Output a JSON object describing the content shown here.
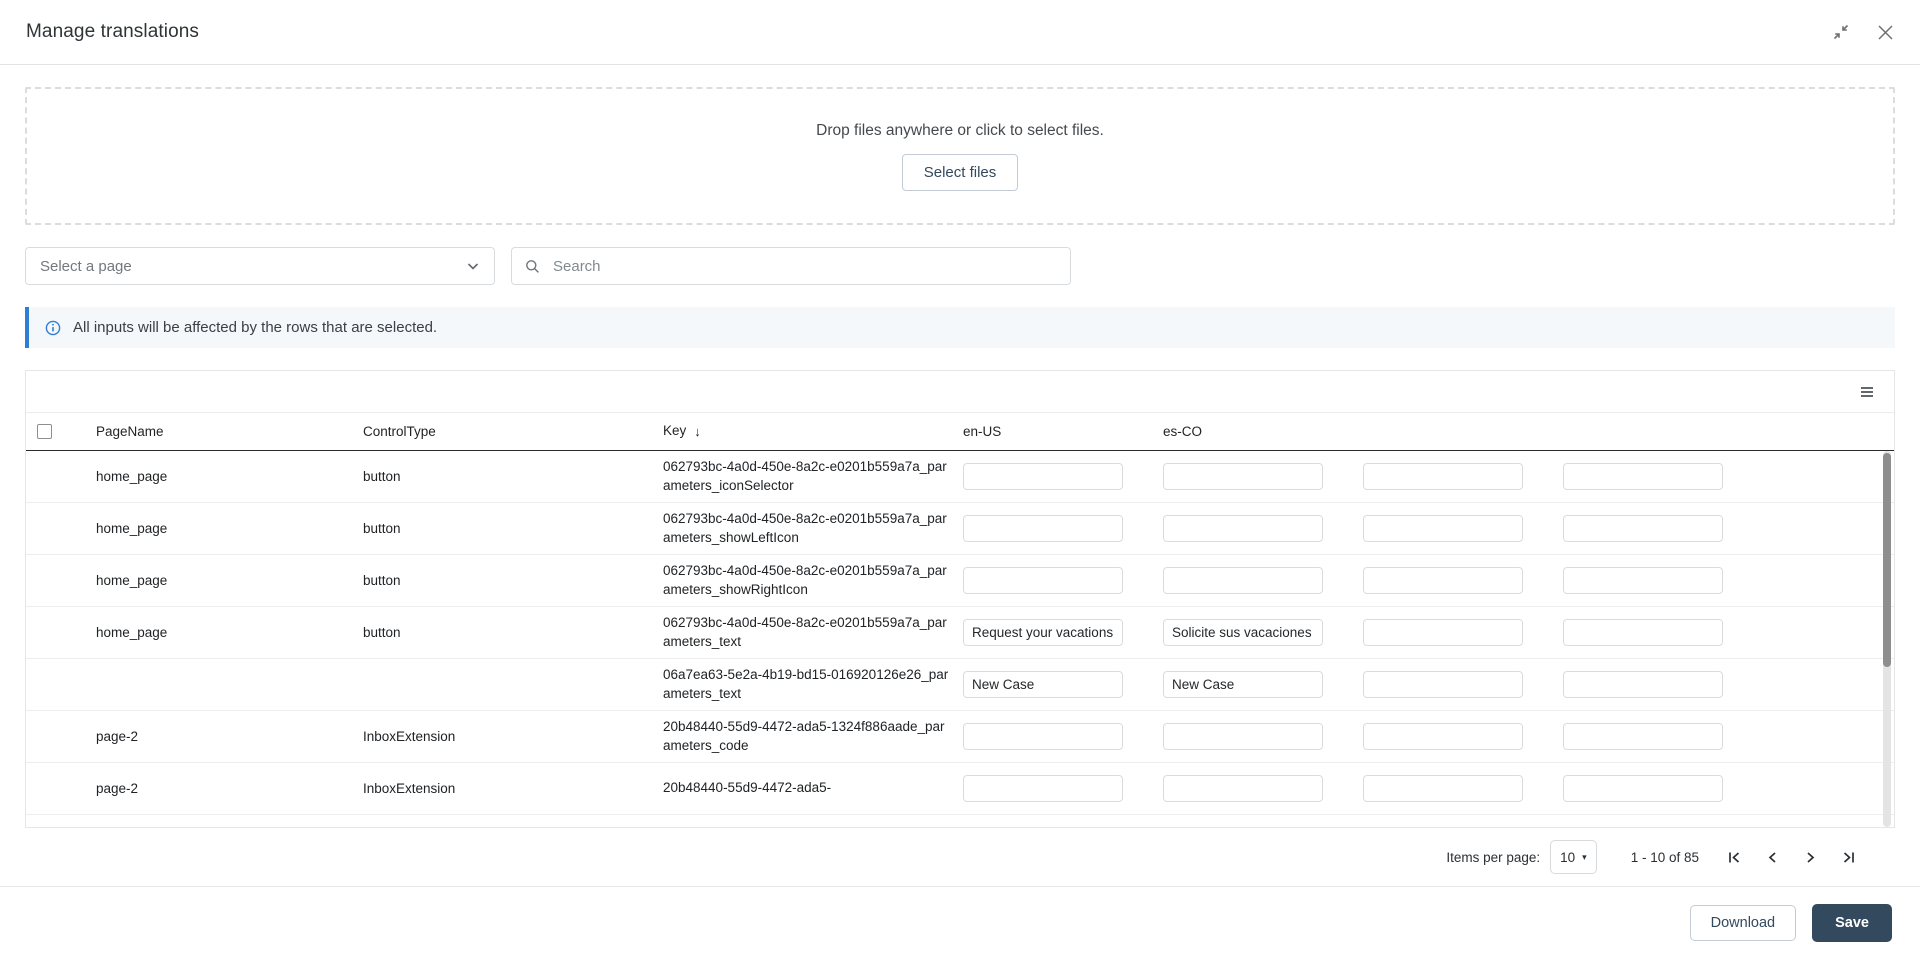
{
  "window": {
    "title": "Manage translations",
    "collapse_icon": "collapse-icon",
    "close_icon": "close-icon"
  },
  "dropzone": {
    "text": "Drop files anywhere or click to select files.",
    "button_label": "Select files"
  },
  "filters": {
    "page_select_label": "Select a page",
    "page_select_icon": "chevron-down-icon",
    "search_placeholder": "Search",
    "search_value": "",
    "search_icon": "search-icon"
  },
  "banner": {
    "icon": "info-icon",
    "text": "All inputs will be affected by the rows that are selected.",
    "accent_color": "#2e7fd4",
    "background_color": "#f4f8fb"
  },
  "table": {
    "menu_icon": "hamburger-menu-icon",
    "columns": [
      {
        "label": "",
        "key": "select"
      },
      {
        "label": "PageName",
        "key": "pagename"
      },
      {
        "label": "ControlType",
        "key": "controltype"
      },
      {
        "label": "Key",
        "key": "key",
        "sorted": true,
        "sort_direction": "desc",
        "sort_glyph": "↓"
      },
      {
        "label": "en-US",
        "key": "en-US"
      },
      {
        "label": "es-CO",
        "key": "es-CO"
      },
      {
        "label": "",
        "key": "col7"
      },
      {
        "label": "",
        "key": "col8"
      }
    ],
    "rows": [
      {
        "pagename": "home_page",
        "controltype": "button",
        "key": "062793bc-4a0d-450e-8a2c-e0201b559a7a_parameters_iconSelector",
        "inputs": [
          "",
          "",
          "",
          ""
        ]
      },
      {
        "pagename": "home_page",
        "controltype": "button",
        "key": "062793bc-4a0d-450e-8a2c-e0201b559a7a_parameters_showLeftIcon",
        "inputs": [
          "",
          "",
          "",
          ""
        ]
      },
      {
        "pagename": "home_page",
        "controltype": "button",
        "key": "062793bc-4a0d-450e-8a2c-e0201b559a7a_parameters_showRightIcon",
        "inputs": [
          "",
          "",
          "",
          ""
        ]
      },
      {
        "pagename": "home_page",
        "controltype": "button",
        "key": "062793bc-4a0d-450e-8a2c-e0201b559a7a_parameters_text",
        "inputs": [
          "Request your vacations",
          "Solicite sus vacaciones",
          "",
          ""
        ]
      },
      {
        "pagename": "",
        "controltype": "",
        "key": "06a7ea63-5e2a-4b19-bd15-016920126e26_parameters_text",
        "inputs": [
          "New Case",
          "New Case",
          "",
          ""
        ]
      },
      {
        "pagename": "page-2",
        "controltype": "InboxExtension",
        "key": "20b48440-55d9-4472-ada5-1324f886aade_parameters_code",
        "inputs": [
          "",
          "",
          "",
          ""
        ]
      },
      {
        "pagename": "page-2",
        "controltype": "InboxExtension",
        "key": "20b48440-55d9-4472-ada5-",
        "inputs": [
          "",
          "",
          "",
          ""
        ]
      }
    ]
  },
  "paginator": {
    "items_per_page_label": "Items per page:",
    "items_per_page_value": "10",
    "caret_glyph": "▾",
    "range_label": "1 - 10 of 85",
    "first_icon": "first-page-icon",
    "prev_icon": "previous-page-icon",
    "next_icon": "next-page-icon",
    "last_icon": "last-page-icon"
  },
  "footer": {
    "download_label": "Download",
    "save_label": "Save",
    "save_color": "#33495e"
  }
}
